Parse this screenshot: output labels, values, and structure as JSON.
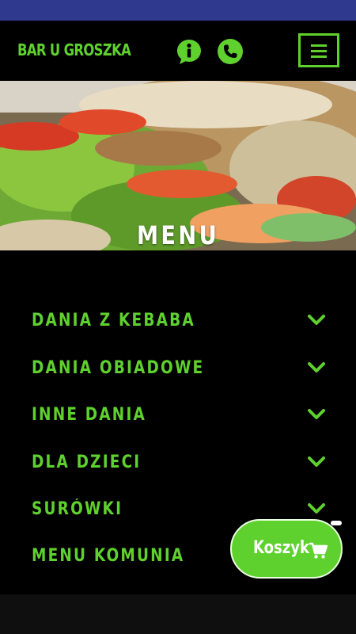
{
  "header": {
    "brand": "BAR U GROSZKA",
    "icons": [
      "info-icon",
      "phone-icon",
      "hamburger-menu-icon"
    ]
  },
  "hero": {
    "title": "MENU"
  },
  "categories": [
    {
      "label": "DANIA Z KEBABA"
    },
    {
      "label": "DANIA OBIADOWE"
    },
    {
      "label": "INNE DANIA"
    },
    {
      "label": "DLA DZIECI"
    },
    {
      "label": "SURÓWKI"
    },
    {
      "label": "MENU KOMUNIA"
    }
  ],
  "cart": {
    "label": "Koszyk"
  },
  "colors": {
    "accent": "#5fd12e",
    "background": "#000000",
    "status_bar": "#2f3a8f"
  }
}
